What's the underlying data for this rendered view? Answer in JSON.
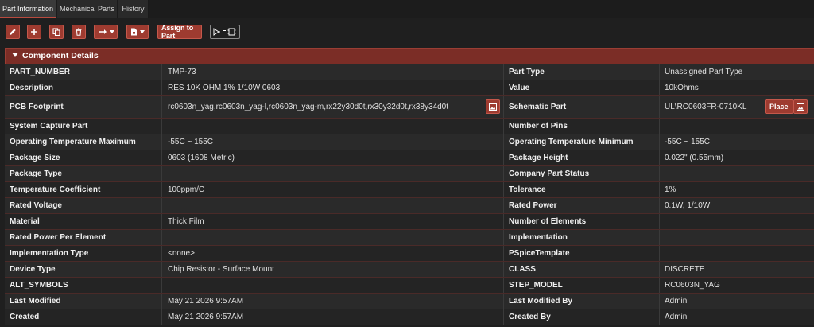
{
  "tabs": [
    {
      "label": "Part Information",
      "active": true
    },
    {
      "label": "Mechanical Parts",
      "active": false
    },
    {
      "label": "History",
      "active": false
    }
  ],
  "toolbar": {
    "edit_icon": "pencil-icon",
    "add_icon": "plus-icon",
    "copy_icon": "copy-icon",
    "delete_icon": "trash-icon",
    "move_icon": "arrow-right-icon",
    "export_icon": "file-icon",
    "assign_label": "Assign to Part",
    "assign_icon": "symbol-equals-footprint-icon"
  },
  "panel": {
    "title": "Component Details"
  },
  "rows": [
    {
      "k1": "PART_NUMBER",
      "v1": "TMP-73",
      "k2": "Part Type",
      "v2": "Unassigned Part Type"
    },
    {
      "k1": "Description",
      "v1": "RES 10K OHM 1% 1/10W 0603",
      "k2": "Value",
      "v2": "10kOhms"
    },
    {
      "k1": "PCB Footprint",
      "v1": "rc0603n_yag,rc0603n_yag-l,rc0603n_yag-m,rx22y30d0t,rx30y32d0t,rx38y34d0t",
      "k2": "Schematic Part",
      "v2": "UL\\RC0603FR-0710KL",
      "place_label": "Place"
    },
    {
      "k1": "System Capture Part",
      "v1": "",
      "k2": "Number of Pins",
      "v2": ""
    },
    {
      "k1": "Operating Temperature Maximum",
      "v1": "-55C ~ 155C",
      "k2": "Operating Temperature Minimum",
      "v2": "-55C ~ 155C"
    },
    {
      "k1": "Package Size",
      "v1": "0603 (1608 Metric)",
      "k2": "Package Height",
      "v2": "0.022\" (0.55mm)"
    },
    {
      "k1": "Package Type",
      "v1": "",
      "k2": "Company Part Status",
      "v2": ""
    },
    {
      "k1": "Temperature Coefficient",
      "v1": "100ppm/C",
      "k2": "Tolerance",
      "v2": "1%"
    },
    {
      "k1": "Rated Voltage",
      "v1": "",
      "k2": "Rated Power",
      "v2": "0.1W, 1/10W"
    },
    {
      "k1": "Material",
      "v1": "Thick Film",
      "k2": "Number of Elements",
      "v2": ""
    },
    {
      "k1": "Rated Power Per Element",
      "v1": "",
      "k2": "Implementation",
      "v2": ""
    },
    {
      "k1": "Implementation Type",
      "v1": "<none>",
      "k2": "PSpiceTemplate",
      "v2": ""
    },
    {
      "k1": "Device Type",
      "v1": "Chip Resistor - Surface Mount",
      "k2": "CLASS",
      "v2": "DISCRETE"
    },
    {
      "k1": "ALT_SYMBOLS",
      "v1": "",
      "k2": "STEP_MODEL",
      "v2": "RC0603N_YAG"
    },
    {
      "k1": "Last Modified",
      "v1": "May 21 2026 9:57AM",
      "k2": "Last Modified By",
      "v2": "Admin"
    },
    {
      "k1": "Created",
      "v1": "May 21 2026 9:57AM",
      "k2": "Created By",
      "v2": "Admin"
    }
  ],
  "colors": {
    "accent": "#9e3b30",
    "panel_header": "#7b2d26",
    "background": "#1f1f1f"
  }
}
